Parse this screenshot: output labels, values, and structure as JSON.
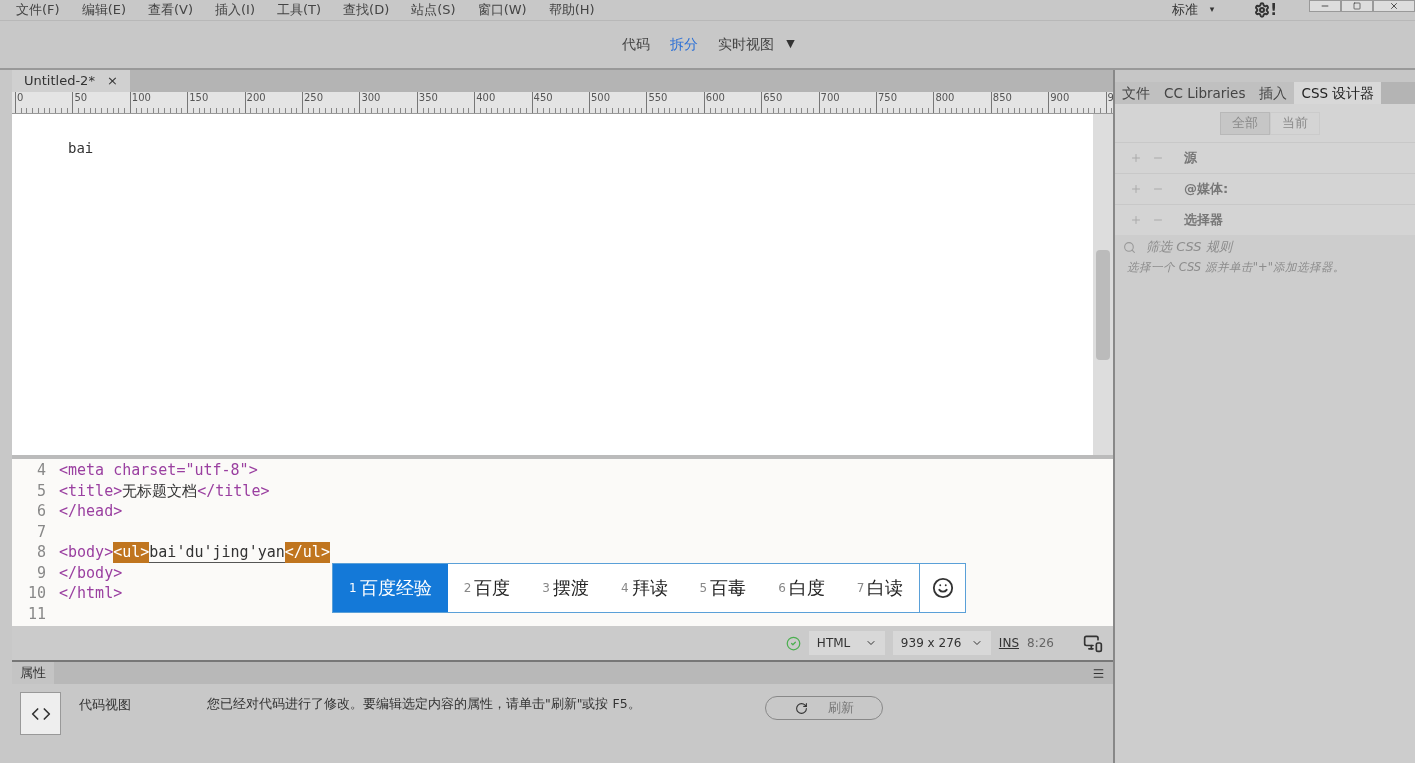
{
  "menu": [
    "文件(F)",
    "编辑(E)",
    "查看(V)",
    "插入(I)",
    "工具(T)",
    "查找(D)",
    "站点(S)",
    "窗口(W)",
    "帮助(H)"
  ],
  "workspace": {
    "label": "标准",
    "caret": "▾"
  },
  "sync_mark": "!",
  "view_modes": [
    {
      "label": "代码",
      "selected": false
    },
    {
      "label": "拆分",
      "selected": true
    },
    {
      "label": "实时视图",
      "selected": false
    }
  ],
  "view_caret": "▼",
  "document_tab": {
    "title": "Untitled-2*",
    "close": "×"
  },
  "ruler": [
    "0",
    "50",
    "100",
    "150",
    "200",
    "250",
    "300",
    "350",
    "400",
    "450",
    "500",
    "550",
    "600",
    "650",
    "700",
    "750",
    "800",
    "850",
    "900",
    "9"
  ],
  "design_text": "bai",
  "code_lines": [
    {
      "number": "4",
      "tokens": [
        {
          "kind": "tag",
          "text": "<meta charset=\"utf-8\">"
        }
      ]
    },
    {
      "number": "5",
      "tokens": [
        {
          "kind": "tag",
          "text": "<title>"
        },
        {
          "kind": "text",
          "text": "无标题文档"
        },
        {
          "kind": "tag",
          "text": "</title>"
        }
      ]
    },
    {
      "number": "6",
      "tokens": [
        {
          "kind": "tag",
          "text": "</head>"
        }
      ]
    },
    {
      "number": "7"
    },
    {
      "number": "8",
      "tokens": [
        {
          "kind": "tag",
          "text": "<body>"
        },
        {
          "kind": "match",
          "text": "<ul>"
        },
        {
          "kind": "composing",
          "text": "bai'du'jing'yan"
        },
        {
          "kind": "match",
          "text": "</ul>"
        }
      ]
    },
    {
      "number": "9",
      "tokens": [
        {
          "kind": "tag",
          "text": "</body>"
        }
      ]
    },
    {
      "number": "10",
      "tokens": [
        {
          "kind": "tag",
          "text": "</html>"
        }
      ]
    },
    {
      "number": "11"
    }
  ],
  "candidates": [
    {
      "index": "1",
      "word": "百度经验",
      "selected": true
    },
    {
      "index": "2",
      "word": "百度",
      "selected": false
    },
    {
      "index": "3",
      "word": "摆渡",
      "selected": false
    },
    {
      "index": "4",
      "word": "拜读",
      "selected": false
    },
    {
      "index": "5",
      "word": "百毒",
      "selected": false
    },
    {
      "index": "6",
      "word": "白度",
      "selected": false
    },
    {
      "index": "7",
      "word": "白读",
      "selected": false
    }
  ],
  "status_bar": {
    "language": "HTML",
    "size": "939 x 276",
    "mode": "INS",
    "position": "8:26"
  },
  "panel_tabs": [
    {
      "label": "文件",
      "selected": false
    },
    {
      "label": "CC Libraries",
      "selected": false
    },
    {
      "label": "插入",
      "selected": false
    },
    {
      "label": "CSS 设计器",
      "selected": true
    }
  ],
  "scope_buttons": [
    {
      "label": "全部",
      "selected": true
    },
    {
      "label": "当前",
      "selected": false
    }
  ],
  "css_sections": [
    "源",
    "@媒体:",
    "选择器"
  ],
  "filter": {
    "placeholder": "筛选 CSS 规则"
  },
  "css_hint": "选择一个 CSS 源并单击\"+\"添加选择器。",
  "properties": {
    "title": "属性",
    "view_label": "代码视图",
    "message": "您已经对代码进行了修改。要编辑选定内容的属性，请单击\"刷新\"或按 F5。",
    "refresh": "刷新"
  }
}
